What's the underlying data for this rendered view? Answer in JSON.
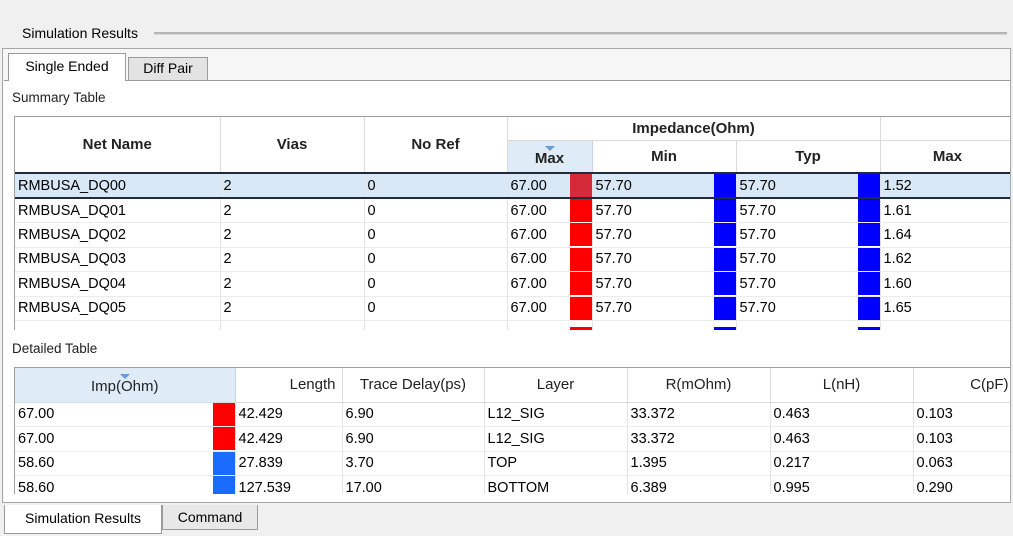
{
  "panel": {
    "title": "Simulation Results"
  },
  "tabs": [
    {
      "label": "Single Ended",
      "active": true
    },
    {
      "label": "Diff Pair",
      "active": false
    }
  ],
  "summary": {
    "label": "Summary Table",
    "headers": {
      "net_name": "Net Name",
      "vias": "Vias",
      "no_ref": "No Ref",
      "impedance_group": "Impedance(Ohm)",
      "imp_max": "Max",
      "imp_min": "Min",
      "imp_typ": "Typ",
      "max2": "Max"
    },
    "rows": [
      {
        "net": "RMBUSA_DQ00",
        "vias": "2",
        "noref": "0",
        "max": "67.00",
        "min": "57.70",
        "typ": "57.70",
        "max2": "1.52",
        "selected": true
      },
      {
        "net": "RMBUSA_DQ01",
        "vias": "2",
        "noref": "0",
        "max": "67.00",
        "min": "57.70",
        "typ": "57.70",
        "max2": "1.61"
      },
      {
        "net": "RMBUSA_DQ02",
        "vias": "2",
        "noref": "0",
        "max": "67.00",
        "min": "57.70",
        "typ": "57.70",
        "max2": "1.64"
      },
      {
        "net": "RMBUSA_DQ03",
        "vias": "2",
        "noref": "0",
        "max": "67.00",
        "min": "57.70",
        "typ": "57.70",
        "max2": "1.62"
      },
      {
        "net": "RMBUSA_DQ04",
        "vias": "2",
        "noref": "0",
        "max": "67.00",
        "min": "57.70",
        "typ": "57.70",
        "max2": "1.60"
      },
      {
        "net": "RMBUSA_DQ05",
        "vias": "2",
        "noref": "0",
        "max": "67.00",
        "min": "57.70",
        "typ": "57.70",
        "max2": "1.65"
      }
    ]
  },
  "detailed": {
    "label": "Detailed Table",
    "headers": [
      "Imp(Ohm)",
      "Length",
      "Trace Delay(ps)",
      "Layer",
      "R(mOhm)",
      "L(nH)",
      "C(pF)"
    ],
    "rows": [
      {
        "imp": "67.00",
        "length": "42.429",
        "delay": "6.90",
        "layer": "L12_SIG",
        "r": "33.372",
        "l": "0.463",
        "c": "0.103",
        "color": "#ff0000"
      },
      {
        "imp": "67.00",
        "length": "42.429",
        "delay": "6.90",
        "layer": "L12_SIG",
        "r": "33.372",
        "l": "0.463",
        "c": "0.103",
        "color": "#ff0000"
      },
      {
        "imp": "58.60",
        "length": "27.839",
        "delay": "3.70",
        "layer": "TOP",
        "r": "1.395",
        "l": "0.217",
        "c": "0.063",
        "color": "#1a6cff"
      },
      {
        "imp": "58.60",
        "length": "127.539",
        "delay": "17.00",
        "layer": "BOTTOM",
        "r": "6.389",
        "l": "0.995",
        "c": "0.290",
        "color": "#1a6cff"
      }
    ]
  },
  "colors": {
    "impedance_high": "#ff0000",
    "impedance_high_selected": "#d42a3a",
    "impedance_low": "#0000ff"
  },
  "bottom_tabs": [
    {
      "label": "Simulation Results",
      "active": true
    },
    {
      "label": "Command",
      "active": false
    }
  ]
}
